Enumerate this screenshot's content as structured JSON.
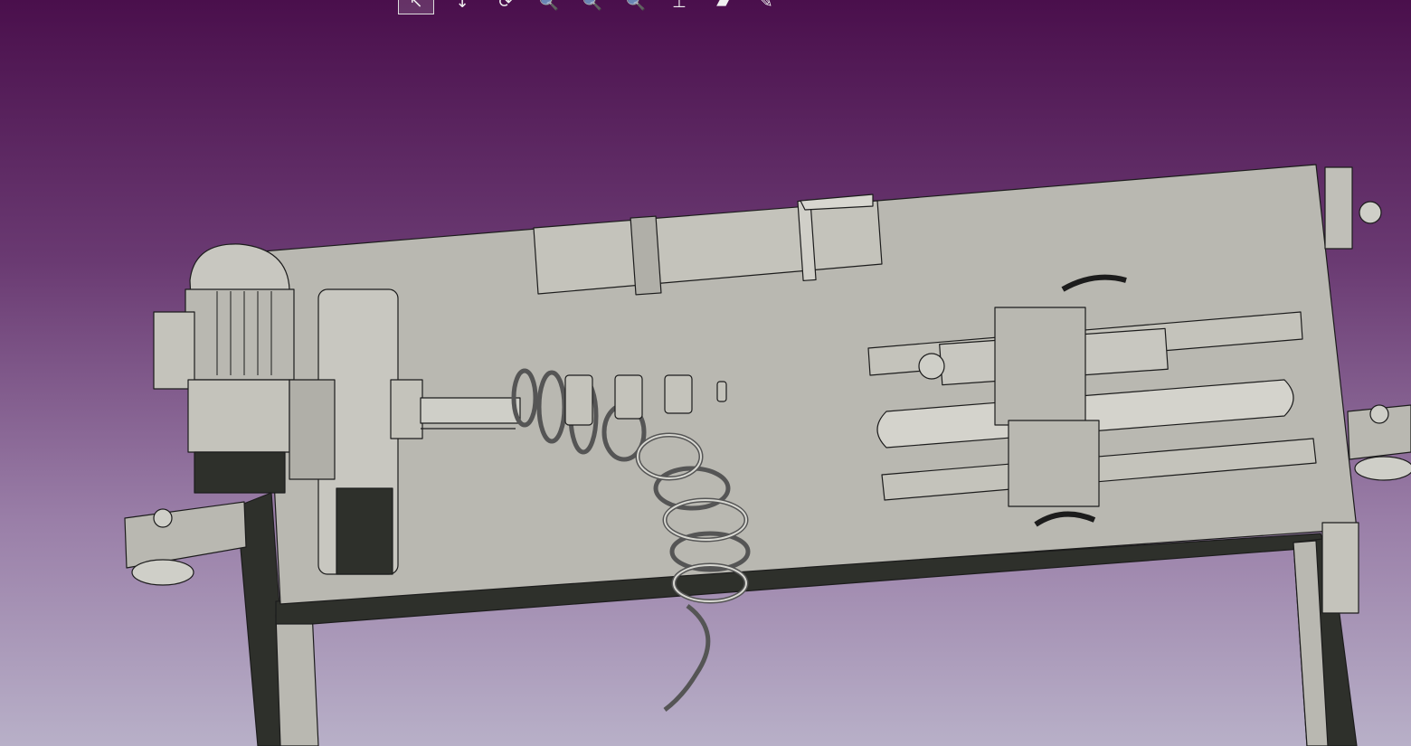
{
  "viewport": {
    "background_top": "#4a0f4c",
    "background_bottom": "#b8b0c8",
    "model_fill": "#b9b8b1",
    "model_dark": "#2e302b",
    "edge_color": "#1c1c1c"
  },
  "toolbar": {
    "buttons": [
      {
        "icon": "select-arrow-icon",
        "glyph": "↖",
        "active": true
      },
      {
        "icon": "pan-icon",
        "glyph": "↕",
        "active": false
      },
      {
        "icon": "rotate-icon",
        "glyph": "⟳",
        "active": false
      },
      {
        "icon": "zoom-icon",
        "glyph": "🔍",
        "active": false
      },
      {
        "icon": "zoom-in-icon",
        "glyph": "🔍",
        "active": false
      },
      {
        "icon": "zoom-out-icon",
        "glyph": "🔍",
        "active": false
      },
      {
        "icon": "fit-all-icon",
        "glyph": "⊥",
        "active": false
      },
      {
        "icon": "view-normal-icon",
        "glyph": "▰",
        "active": false
      },
      {
        "icon": "view-edit-icon",
        "glyph": "✎",
        "active": false
      }
    ]
  }
}
